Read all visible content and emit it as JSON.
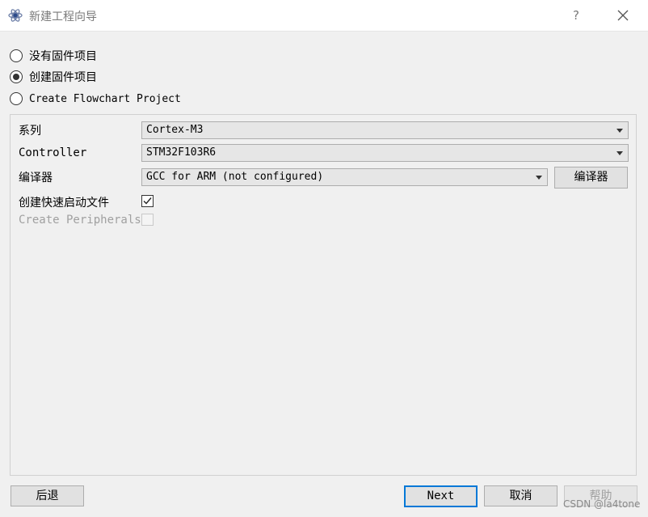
{
  "window": {
    "title": "新建工程向导",
    "help_label": "?"
  },
  "options": [
    {
      "label": "没有固件项目",
      "checked": false
    },
    {
      "label": "创建固件项目",
      "checked": true
    },
    {
      "label": "Create Flowchart Project",
      "checked": false
    }
  ],
  "form": {
    "series_label": "系列",
    "series_value": "Cortex-M3",
    "controller_label": "Controller",
    "controller_value": "STM32F103R6",
    "compiler_label": "编译器",
    "compiler_value": "GCC for ARM (not configured)",
    "compiler_button": "编译器",
    "quickstart_label": "创建快速启动文件",
    "quickstart_checked": true,
    "peripherals_label": "Create Peripherals",
    "peripherals_checked": false
  },
  "footer": {
    "back_label": "后退",
    "next_label": "Next",
    "cancel_label": "取消",
    "help_label": "帮助"
  },
  "watermark": "CSDN @la4tone",
  "colors": {
    "accent": "#0078d7",
    "disabled_text": "#a0a0a0"
  }
}
